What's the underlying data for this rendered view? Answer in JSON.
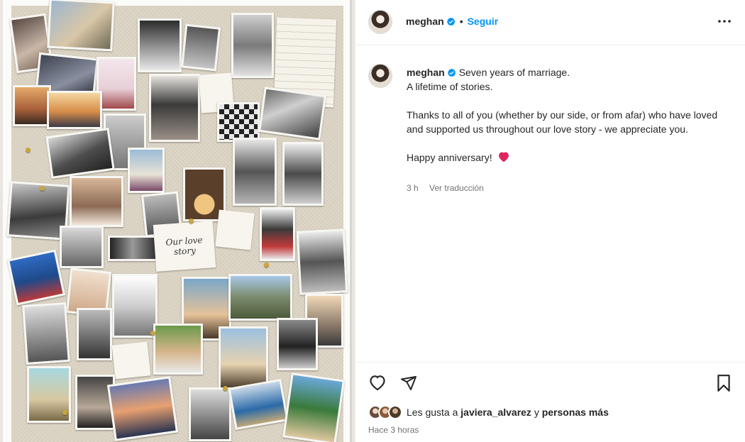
{
  "post": {
    "username": "meghan",
    "follow_label": "Seguir",
    "separator": "•",
    "caption_lines": [
      "Seven years of marriage.",
      "A lifetime of stories.",
      "Thanks to all of you (whether by our side, or from afar) who have loved and supported us throughout our love story - we appreciate you.",
      "Happy anniversary!"
    ],
    "caption_emoji": "heart",
    "time_ago": "3 h",
    "translate_label": "Ver traducción",
    "likes_prefix": "Les gusta a",
    "likes_user": "javiera_alvarez",
    "likes_join": "y",
    "likes_others": "personas más",
    "post_time": "Hace 3 horas"
  },
  "board": {
    "note_text": "Our love story"
  },
  "colors": {
    "accent": "#0095f6",
    "verified": "#0095f6",
    "heart_emoji": "#e0245e",
    "text": "#262626",
    "secondary": "#737373"
  },
  "icons": [
    "verified-badge-icon",
    "more-options-icon",
    "like-icon",
    "share-icon",
    "save-icon",
    "heart-emoji-icon"
  ]
}
